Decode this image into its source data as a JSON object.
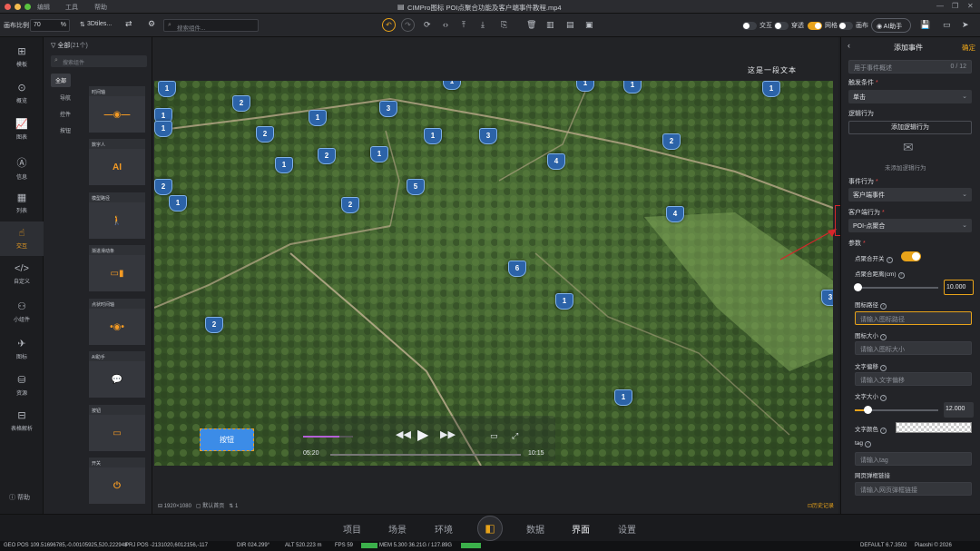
{
  "titlebar": {
    "menus": [
      "编辑",
      "工具",
      "帮助"
    ],
    "title": "CIMPro图标 POI点聚合功能及客户端事件教程.mp4"
  },
  "toolbar": {
    "scale_label": "画布比例",
    "scale_value": "70",
    "scale_unit": "%",
    "tiles_label": "3Dtiles...",
    "search_placeholder": "搜索组件...",
    "toggles": [
      {
        "label": "交互",
        "on": false
      },
      {
        "label": "穿透",
        "on": false
      },
      {
        "label": "网格",
        "on": true
      },
      {
        "label": "画布",
        "on": false
      }
    ],
    "ai_label": "AI助手"
  },
  "leftnav": [
    {
      "label": "模板",
      "icon": "template-icon",
      "glyph": "⊞"
    },
    {
      "label": "概览",
      "icon": "overview-icon",
      "glyph": "⊙"
    },
    {
      "label": "图表",
      "icon": "chart-icon",
      "glyph": "📈"
    },
    {
      "label": "信息",
      "icon": "info-icon",
      "glyph": "Ⓐ"
    },
    {
      "label": "列表",
      "icon": "list-icon",
      "glyph": "▦"
    },
    {
      "label": "交互",
      "icon": "interaction-icon",
      "glyph": "☝",
      "active": true
    },
    {
      "label": "自定义",
      "icon": "code-icon",
      "glyph": "</>"
    },
    {
      "label": "小组件",
      "icon": "widget-icon",
      "glyph": "⚇"
    },
    {
      "label": "图标",
      "icon": "plane-icon",
      "glyph": "✈"
    },
    {
      "label": "资源",
      "icon": "resource-icon",
      "glyph": "⛁"
    },
    {
      "label": "表格解析",
      "icon": "table-parse-icon",
      "glyph": "⊟"
    }
  ],
  "help_label": "帮助",
  "comppanel": {
    "header": "全部",
    "count": "(21个)",
    "search_placeholder": "搜索组件",
    "categories": [
      "全部",
      "导航",
      "控件",
      "按钮"
    ],
    "cards": [
      {
        "title": "时间轴",
        "icon": "timeline-icon"
      },
      {
        "title": "数字人",
        "icon": "ai-icon"
      },
      {
        "title": "模型路径",
        "icon": "walker-icon"
      },
      {
        "title": "渐进滑动条",
        "icon": "slider-icon"
      },
      {
        "title": "点状时间轴",
        "icon": "dot-timeline-icon"
      },
      {
        "title": "AI助手",
        "icon": "ai-chat-icon"
      },
      {
        "title": "按钮",
        "icon": "button-icon"
      },
      {
        "title": "开关",
        "icon": "power-icon"
      }
    ]
  },
  "canvas": {
    "header_text": "这是一段文本",
    "button_label": "按钮",
    "player_time_start": "05:20",
    "player_time_end": "10:15",
    "progress": 0.2,
    "pois": [
      "1",
      "1",
      "1",
      "1",
      "1",
      "2",
      "3",
      "1",
      "1",
      "1",
      "2",
      "3",
      "2",
      "2",
      "1",
      "1",
      "2",
      "4",
      "1",
      "5",
      "2",
      "4",
      "6",
      "1",
      "2",
      "3",
      "1",
      "1"
    ],
    "annotation_box_color": "#d6262b"
  },
  "canvas_footer": {
    "resolution": "1920×1080",
    "page": "默认首页",
    "count": "1",
    "history": "历史记录"
  },
  "rightpanel": {
    "title": "添加事件",
    "confirm": "确定",
    "desc_placeholder": "用于事件概述",
    "desc_count": "0 / 12",
    "trigger_label": "触发条件",
    "trigger_value": "单击",
    "logic_label": "逻辑行为",
    "add_logic": "添加逻辑行为",
    "no_logic": "未添加逻辑行为",
    "event_label": "事件行为",
    "event_value": "客户端事件",
    "client_label": "客户端行为",
    "client_value": "POI-点聚合",
    "params_label": "参数",
    "cluster_switch_label": "点聚合开关",
    "cluster_switch_on": true,
    "cluster_dist_label": "点聚合距离(cm)",
    "cluster_dist_value": "10.000",
    "cluster_dist_fraction": 0.0,
    "icon_path_label": "图标路径",
    "icon_path_placeholder": "请输入图标路径",
    "icon_size_label": "图标大小",
    "icon_size_placeholder": "请输入图标大小",
    "text_offset_label": "文字偏移",
    "text_offset_placeholder": "请输入文字偏移",
    "font_size_label": "文字大小",
    "font_size_value": "12.000",
    "font_size_fraction": 0.12,
    "text_color_label": "文字颜色",
    "tag_label": "tag",
    "tag_placeholder": "请输入tag",
    "link_label": "网页弹框链接",
    "link_placeholder": "请输入网页弹框链接"
  },
  "bottombar": {
    "tabs": [
      "项目",
      "场景",
      "环境",
      "数据",
      "界面",
      "设置"
    ]
  },
  "statusbar": {
    "geo_pos": "GEO POS 109.51696785,-0.00105925,520.222948",
    "prj_pos": "PRJ POS -2131020,6012156,-117",
    "dir": "DIR 024.299°",
    "alt": "ALT 520.223 m",
    "fps": "FPS 59",
    "mem": "MEM 5.300 36.21G / 127.89G",
    "scene": "DEFAULT 6.7.3502",
    "brand": "Piaoshi © 2026"
  }
}
